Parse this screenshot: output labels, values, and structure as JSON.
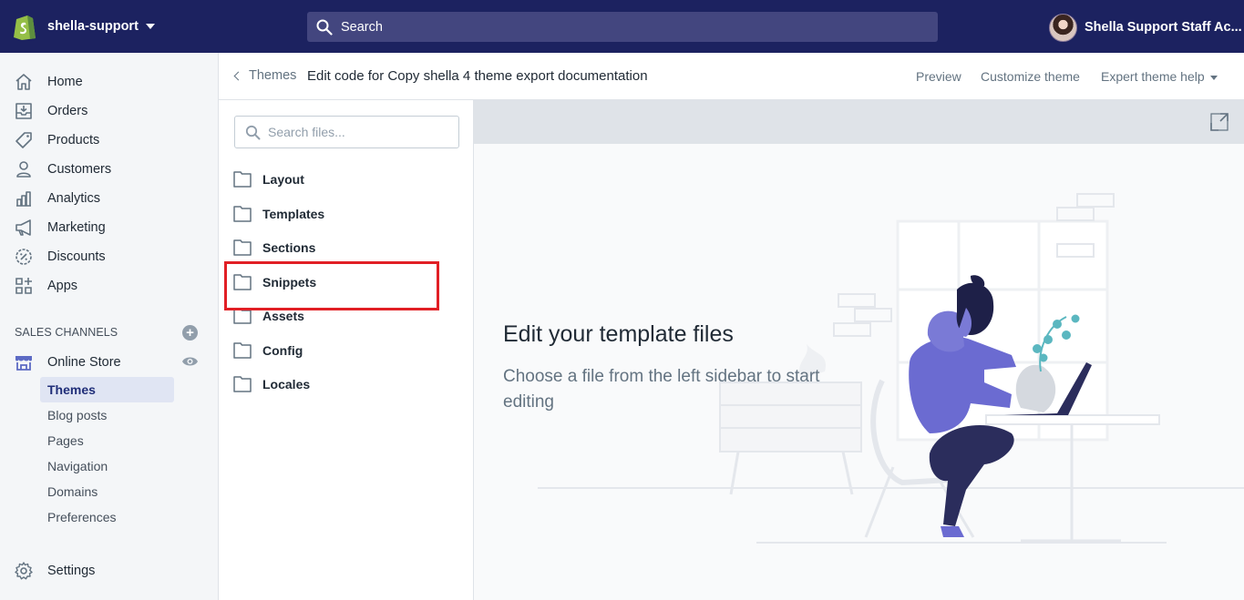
{
  "topbar": {
    "store_name": "shella-support",
    "search_placeholder": "Search",
    "user_name": "Shella Support Staff Ac..."
  },
  "sidebar": {
    "items": [
      {
        "label": "Home",
        "icon": "home-icon"
      },
      {
        "label": "Orders",
        "icon": "orders-icon"
      },
      {
        "label": "Products",
        "icon": "tag-icon"
      },
      {
        "label": "Customers",
        "icon": "person-icon"
      },
      {
        "label": "Analytics",
        "icon": "bar-chart-icon"
      },
      {
        "label": "Marketing",
        "icon": "megaphone-icon"
      },
      {
        "label": "Discounts",
        "icon": "discount-icon"
      },
      {
        "label": "Apps",
        "icon": "apps-icon"
      }
    ],
    "sales_channels_title": "SALES CHANNELS",
    "online_store": "Online Store",
    "online_store_sub": [
      "Themes",
      "Blog posts",
      "Pages",
      "Navigation",
      "Domains",
      "Preferences"
    ],
    "active_sub": "Themes",
    "settings": "Settings"
  },
  "header": {
    "back_label": "Themes",
    "edit_prefix": "Edit code for",
    "theme_name": "Copy shella 4 theme export documentation",
    "links": [
      "Preview",
      "Customize theme",
      "Expert theme help"
    ]
  },
  "files": {
    "search_placeholder": "Search files...",
    "folders": [
      "Layout",
      "Templates",
      "Sections",
      "Snippets",
      "Assets",
      "Config",
      "Locales"
    ],
    "highlighted": "Snippets"
  },
  "main": {
    "title": "Edit your template files",
    "subtitle": "Choose a file from the left sidebar to start editing"
  },
  "colors": {
    "topbar": "#1c2260",
    "search_bg": "#43467f",
    "highlight": "#e11f25",
    "illustration_purple": "#6b6bd1",
    "illustration_navy": "#2b2d5c"
  }
}
